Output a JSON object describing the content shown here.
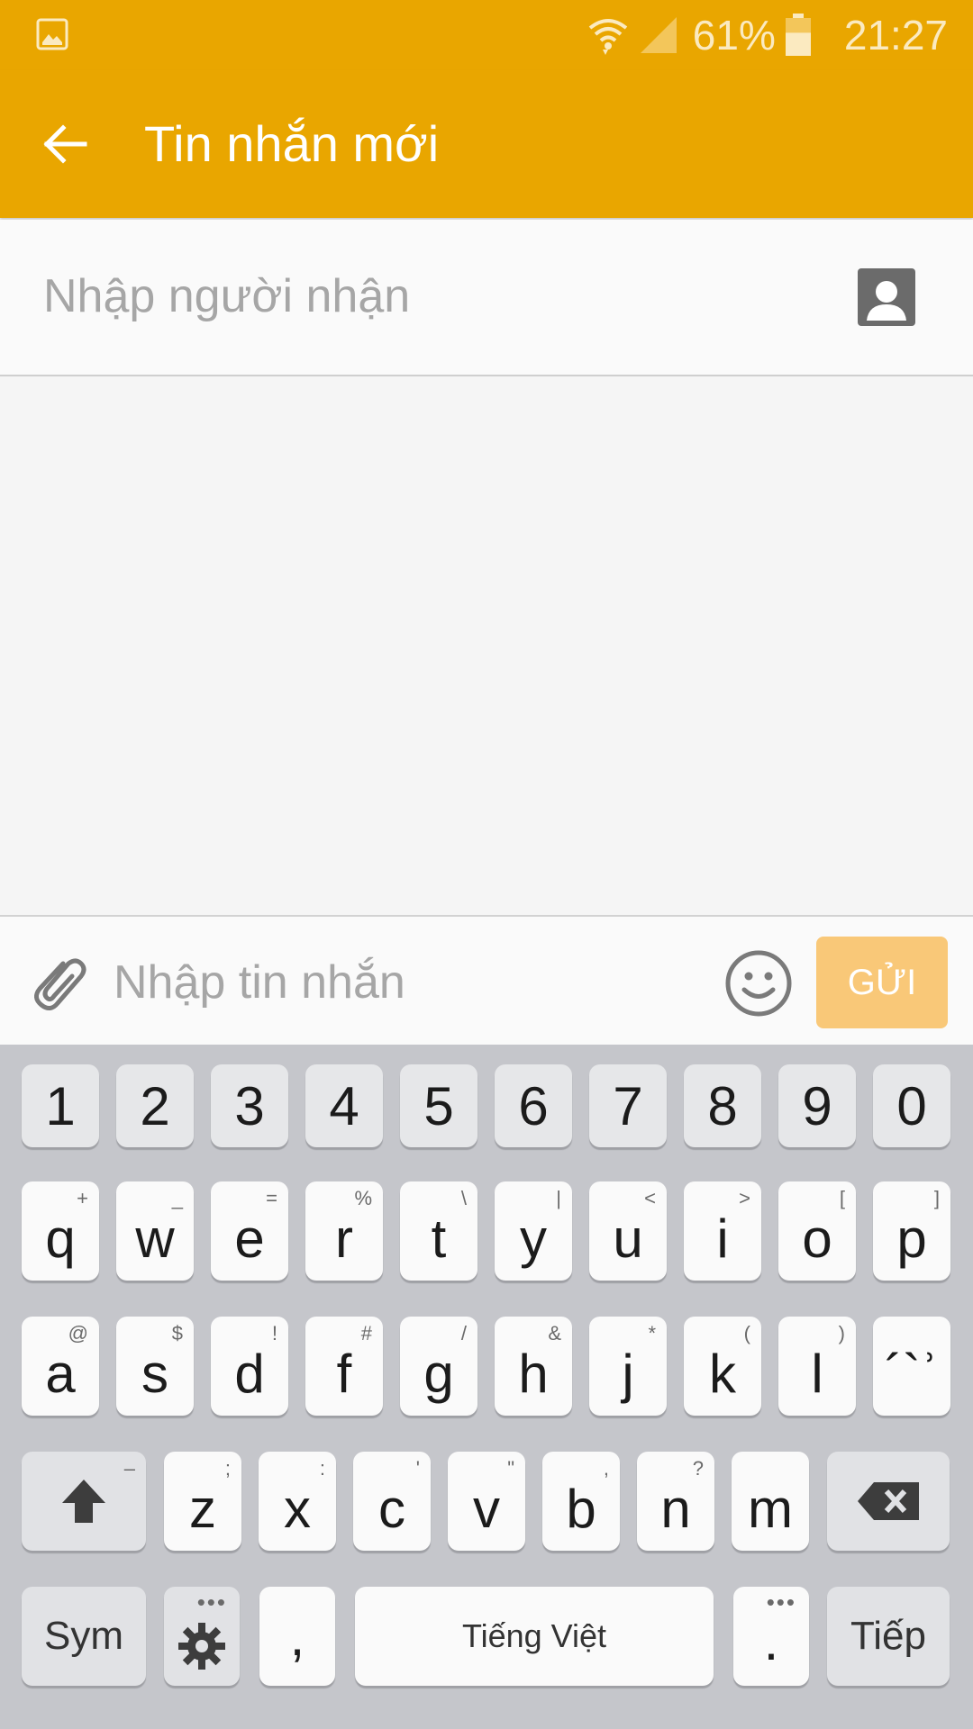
{
  "status_bar": {
    "battery_percent": "61%",
    "battery_level": 0.61,
    "time": "21:27",
    "icons": [
      "image-notification-icon",
      "wifi-icon",
      "signal-icon",
      "battery-icon"
    ]
  },
  "app_bar": {
    "title": "Tin nhắn mới",
    "back_icon": "arrow-left-icon"
  },
  "recipient": {
    "placeholder": "Nhập người nhận",
    "value": "",
    "contact_icon": "contact-icon"
  },
  "compose": {
    "placeholder": "Nhập tin nhắn",
    "value": "",
    "attach_icon": "paperclip-icon",
    "emoji_icon": "smiley-icon",
    "send_label": "GỬI"
  },
  "keyboard": {
    "number_row": [
      "1",
      "2",
      "3",
      "4",
      "5",
      "6",
      "7",
      "8",
      "9",
      "0"
    ],
    "row1": [
      {
        "main": "q",
        "hint": "+"
      },
      {
        "main": "w",
        "hint": "_"
      },
      {
        "main": "e",
        "hint": "="
      },
      {
        "main": "r",
        "hint": "%"
      },
      {
        "main": "t",
        "hint": "\\"
      },
      {
        "main": "y",
        "hint": "|"
      },
      {
        "main": "u",
        "hint": "<"
      },
      {
        "main": "i",
        "hint": ">"
      },
      {
        "main": "o",
        "hint": "["
      },
      {
        "main": "p",
        "hint": "]"
      }
    ],
    "row2": [
      {
        "main": "a",
        "hint": "@"
      },
      {
        "main": "s",
        "hint": "$"
      },
      {
        "main": "d",
        "hint": "!"
      },
      {
        "main": "f",
        "hint": "#"
      },
      {
        "main": "g",
        "hint": "/"
      },
      {
        "main": "h",
        "hint": "&"
      },
      {
        "main": "j",
        "hint": "*"
      },
      {
        "main": "k",
        "hint": "("
      },
      {
        "main": "l",
        "hint": ")"
      },
      {
        "main": "´`ʾ",
        "hint": ""
      }
    ],
    "row3": [
      {
        "main": "z",
        "hint": ";"
      },
      {
        "main": "x",
        "hint": ":"
      },
      {
        "main": "c",
        "hint": "'"
      },
      {
        "main": "v",
        "hint": "\""
      },
      {
        "main": "b",
        "hint": ","
      },
      {
        "main": "n",
        "hint": "?"
      },
      {
        "main": "m",
        "hint": ""
      }
    ],
    "shift_hint": "–",
    "sym_label": "Sym",
    "comma_label": ",",
    "space_label": "Tiếng Việt",
    "period_label": ".",
    "next_label": "Tiếp",
    "settings_icon": "gear-icon",
    "shift_icon": "shift-arrow-icon",
    "backspace_icon": "backspace-icon"
  },
  "colors": {
    "app_bar": "#e9a600",
    "send_button": "#f9c878",
    "keyboard_bg": "#c5c6cb"
  }
}
